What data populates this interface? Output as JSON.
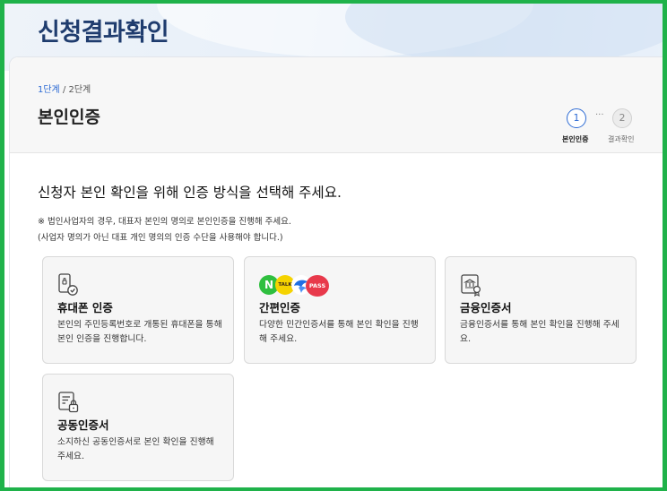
{
  "page": {
    "title": "신청결과확인"
  },
  "breadcrumb": {
    "current": "1단계",
    "separator": " / ",
    "next": "2단계"
  },
  "step": {
    "title": "본인인증"
  },
  "stepper": {
    "steps": [
      {
        "number": "1",
        "label": "본인인증",
        "active": true
      },
      {
        "number": "2",
        "label": "결과확인",
        "active": false
      }
    ],
    "dots": "···"
  },
  "content": {
    "intro": "신청자 본인 확인을 위해 인증 방식을 선택해 주세요.",
    "note_line1": "※ 법인사업자의 경우, 대표자 본인의 명의로 본인인증을 진행해 주세요.",
    "note_line2": "(사업자 명의가 아닌 대표 개인 명의의 인증 수단을 사용해야 합니다.)"
  },
  "methods": [
    {
      "title": "휴대폰 인증",
      "desc": "본인의 주민등록번호로 개통된 휴대폰을 통해 본인 인증을 진행합니다.",
      "icon": "phone-shield-icon"
    },
    {
      "title": "간편인증",
      "desc": "다양한 민간인증서를 통해 본인 확인을 진행해 주세요.",
      "icon": "simple-auth-logos",
      "logos": {
        "naver": "N",
        "kakao": "TALK",
        "pass": "PASS"
      }
    },
    {
      "title": "금융인증서",
      "desc": "금융인증서를 통해 본인 확인을 진행해 주세요.",
      "icon": "bank-certificate-icon"
    },
    {
      "title": "공동인증서",
      "desc": "소지하신 공동인증서로 본인 확인을 진행해 주세요.",
      "icon": "document-lock-icon"
    }
  ],
  "colors": {
    "frame": "#1fb24a",
    "accent": "#2d6bd4",
    "title": "#1f3c6e"
  }
}
